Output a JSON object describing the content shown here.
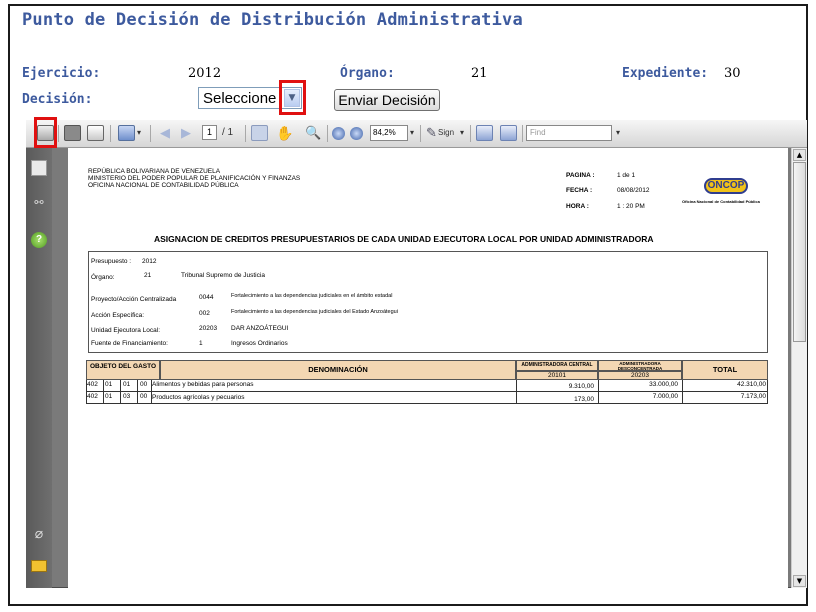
{
  "page": {
    "title": "Punto de Decisión de Distribución Administrativa",
    "ejercicio_label": "Ejercicio:",
    "ejercicio_value": "2012",
    "organo_label": "Órgano:",
    "organo_value": "21",
    "expediente_label": "Expediente:",
    "expediente_value": "30",
    "decision_label": "Decisión:",
    "decision_select_value": "Seleccione",
    "enviar_button": "Enviar Decisión"
  },
  "toolbar": {
    "page_input": "1",
    "page_total": "/ 1",
    "zoom": "84,2%",
    "sign_label": "Sign",
    "find_placeholder": "Find",
    "icons": [
      "print-icon",
      "save-icon",
      "email-icon",
      "upload-icon",
      "prev-page-icon",
      "next-page-icon",
      "select-text-icon",
      "hand-icon",
      "zoom-tool-icon",
      "zoom-out-icon",
      "zoom-in-icon",
      "sign-pen-icon",
      "fit-width-icon",
      "fit-page-icon"
    ]
  },
  "sidebar": {
    "icons": [
      "pages-icon",
      "binoculars-icon",
      "help-icon",
      "attachment-icon",
      "comments-icon"
    ]
  },
  "document": {
    "header_lines": [
      "REPÚBLICA BOLIVARIANA DE VENEZUELA",
      "MINISTERIO DEL PODER POPULAR DE PLANIFICACIÓN Y FINANZAS",
      "OFICINA NACIONAL DE CONTABILIDAD PÚBLICA"
    ],
    "pagina_label": "PAGINA :",
    "pagina_value": "1  de  1",
    "fecha_label": "FECHA :",
    "fecha_value": "08/08/2012",
    "hora_label": "HORA :",
    "hora_value": "1 : 20 PM",
    "logo_text": "ONCOP",
    "logo_caption": "Oficina Nacional de Contabilidad Pública",
    "report_title": "ASIGNACION DE CREDITOS PRESUPUESTARIOS DE CADA UNIDAD EJECUTORA LOCAL POR UNIDAD ADMINISTRADORA",
    "info": [
      {
        "label": "Presupuesto :",
        "code": "2012",
        "desc": ""
      },
      {
        "label": "Órgano:",
        "code": "21",
        "desc": "Tribunal Supremo de Justicia"
      },
      {
        "label": "Proyecto/Acción Centralizada",
        "code": "0044",
        "desc": "Fortalecimiento a las dependencias judiciales en el ámbito estadal"
      },
      {
        "label": "Acción Específica:",
        "code": "002",
        "desc": "Fortalecimiento a las dependencias judiciales del Estado Anzoátegui"
      },
      {
        "label": "Unidad Ejecutora Local:",
        "code": "20203",
        "desc": "DAR  ANZOÁTEGUI"
      },
      {
        "label": "Fuente de Financiamiento:",
        "code": "1",
        "desc": "Ingresos Ordinarios"
      }
    ],
    "table": {
      "col_objeto": "OBJETO DEL GASTO",
      "col_denominacion": "DENOMINACIÓN",
      "col_central": "ADMINISTRADORA CENTRAL",
      "col_central_code": "20101",
      "col_desconc": "ADMINISTRADORA DESCONCENTRADA",
      "col_desconc_code": "20203",
      "col_total": "TOTAL",
      "rows": [
        {
          "c1": "402",
          "c2": "01",
          "c3": "01",
          "c4": "00",
          "denominacion": "Alimentos y bebidas para personas",
          "central": "9.310,00",
          "desconc": "33.000,00",
          "total": "42.310,00"
        },
        {
          "c1": "402",
          "c2": "01",
          "c3": "03",
          "c4": "00",
          "denominacion": "Productos agrícolas y pecuarios",
          "central": "173,00",
          "desconc": "7.000,00",
          "total": "7.173,00"
        }
      ]
    }
  }
}
